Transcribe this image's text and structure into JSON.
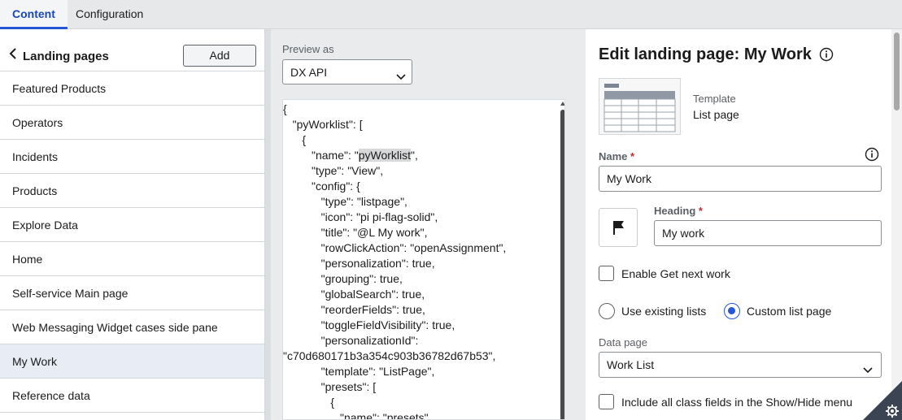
{
  "tabs": [
    {
      "label": "Content",
      "active": true
    },
    {
      "label": "Configuration",
      "active": false
    }
  ],
  "landing": {
    "title": "Landing pages",
    "add_label": "Add",
    "items": [
      {
        "label": "Featured Products"
      },
      {
        "label": "Operators"
      },
      {
        "label": "Incidents"
      },
      {
        "label": "Products"
      },
      {
        "label": "Explore Data"
      },
      {
        "label": "Home"
      },
      {
        "label": "Self-service Main page"
      },
      {
        "label": "Web Messaging Widget cases side pane"
      },
      {
        "label": "My Work",
        "selected": true
      },
      {
        "label": "Reference data"
      }
    ]
  },
  "preview": {
    "label": "Preview as",
    "selected": "DX API",
    "code_lines": [
      "{",
      "   \"pyWorklist\": [",
      "      {",
      "         \"name\": \"",
      "         \"type\": \"View\",",
      "         \"config\": {",
      "            \"type\": \"listpage\",",
      "            \"icon\": \"pi pi-flag-solid\",",
      "            \"title\": \"@L My work\",",
      "            \"rowClickAction\": \"openAssignment\",",
      "            \"personalization\": true,",
      "            \"grouping\": true,",
      "            \"globalSearch\": true,",
      "            \"reorderFields\": true,",
      "            \"toggleFieldVisibility\": true,",
      "            \"personalizationId\":",
      "\"c70d680171b3a354c903b36782d67b53\",",
      "            \"template\": \"ListPage\",",
      "            \"presets\": [",
      "               {",
      "                  \"name\": \"presets\","
    ],
    "highlight_word": "pyWorklist",
    "highlight_suffix": "\","
  },
  "edit": {
    "title": "Edit landing page: My Work",
    "template_label": "Template",
    "template_value": "List page",
    "name_label": "Name",
    "required_mark": "*",
    "name_value": "My Work",
    "heading_label": "Heading",
    "heading_value": "My work",
    "icon_name": "flag-icon",
    "enable_next_label": "Enable Get next work",
    "enable_next_checked": false,
    "radio_existing_label": "Use existing lists",
    "radio_custom_label": "Custom list page",
    "radio_selected": "custom",
    "data_page_label": "Data page",
    "data_page_value": "Work List",
    "include_fields_label": "Include all class fields in the Show/Hide menu",
    "include_fields_checked": false
  },
  "colors": {
    "accent": "#2457d6",
    "required": "#c72c2c",
    "selected_row": "#e7ecf5"
  }
}
